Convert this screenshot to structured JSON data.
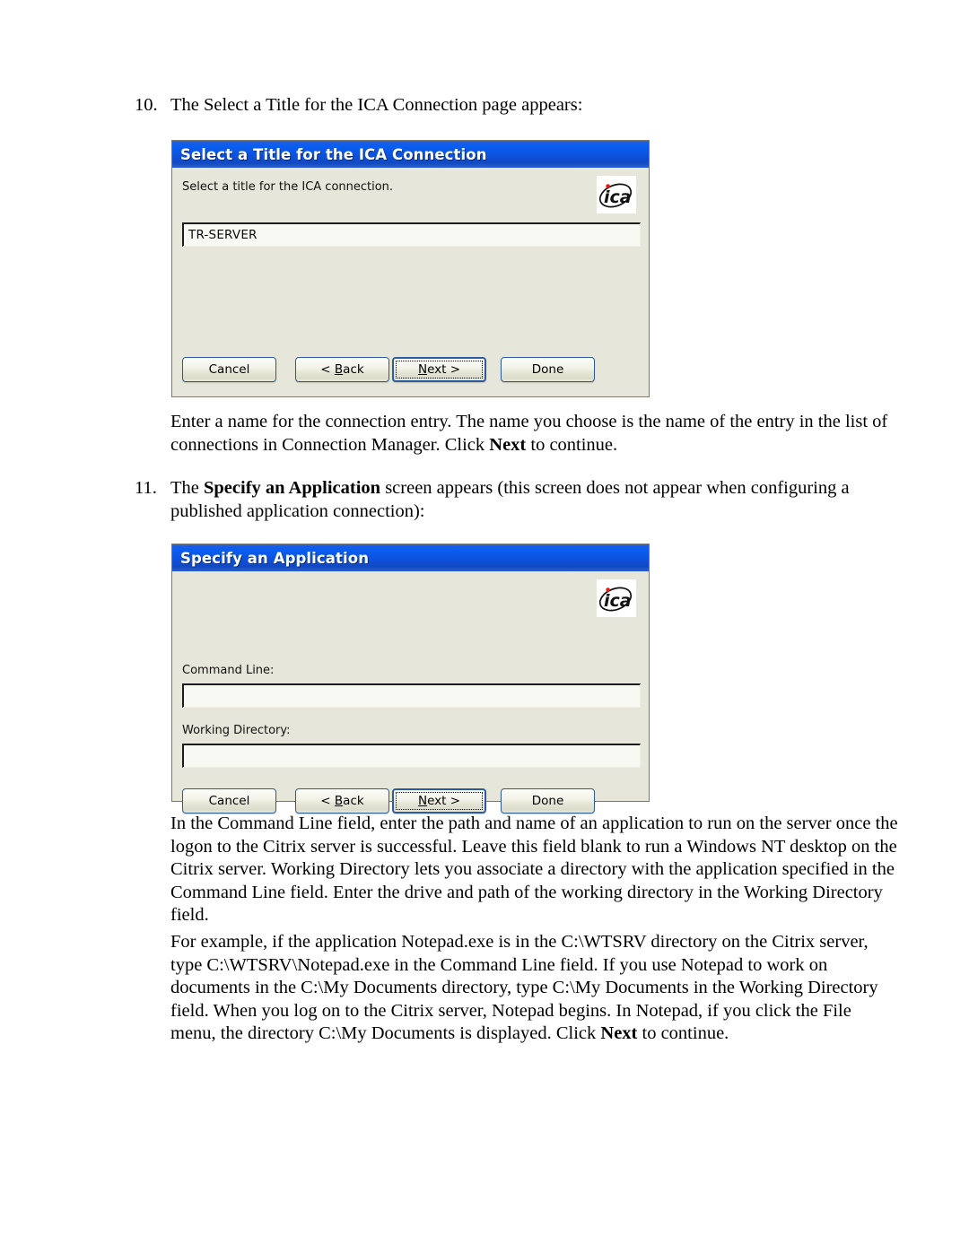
{
  "document": {
    "steps": [
      {
        "number": "10.",
        "text_parts": [
          {
            "text": "The Select a Title for the ICA Connection page appears:",
            "bold": false
          }
        ]
      },
      {
        "number": "11.",
        "text_parts": [
          {
            "text": "The ",
            "bold": false
          },
          {
            "text": "Specify an Application",
            "bold": true
          },
          {
            "text": " screen appears (this screen does not appear when configuring a published application connection):",
            "bold": false
          }
        ]
      }
    ],
    "paragraph_after_dialog1": [
      {
        "text": "Enter a name for the connection entry. The name you choose is the name of the entry in the list of connections in Connection Manager. Click ",
        "bold": false
      },
      {
        "text": "Next",
        "bold": true
      },
      {
        "text": " to continue.",
        "bold": false
      }
    ],
    "paragraph_after_dialog2_a": [
      {
        "text": "In the Command Line field, enter the path and name of an application to run on the server once the logon to the Citrix server is successful. Leave this field blank to run a Windows NT desktop on the Citrix server. Working Directory lets you associate a directory with the application specified in the Command Line field. Enter the drive and path of the working directory in the Working Directory field.",
        "bold": false
      }
    ],
    "paragraph_after_dialog2_b": [
      {
        "text": "For example, if the application Notepad.exe is in the C:\\WTSRV directory on the Citrix server, type C:\\WTSRV\\Notepad.exe in the Command Line field. If you use Notepad to work on documents in the C:\\My Documents directory, type C:\\My Documents in the Working Directory field. When you log on to the Citrix server, Notepad begins. In Notepad, if you click the File menu, the directory C:\\My Documents is displayed. Click ",
        "bold": false
      },
      {
        "text": "Next",
        "bold": true
      },
      {
        "text": " to continue.",
        "bold": false
      }
    ]
  },
  "dialog1": {
    "title": "Select a Title for the ICA Connection",
    "description": "Select a title for the ICA connection.",
    "logo": "ica-logo",
    "title_field": {
      "value": "TR-SERVER",
      "placeholder": ""
    },
    "buttons": {
      "cancel": "Cancel",
      "back_prefix": "< ",
      "back_accel": "B",
      "back_suffix": "ack",
      "next_accel": "N",
      "next_suffix": "ext >",
      "done": "Done"
    }
  },
  "dialog2": {
    "title": "Specify an Application",
    "logo": "ica-logo",
    "command_line_label": "Command Line:",
    "command_line_value": "",
    "working_directory_label": "Working Directory:",
    "working_directory_value": "",
    "buttons": {
      "cancel": "Cancel",
      "back_prefix": "< ",
      "back_accel": "B",
      "back_suffix": "ack",
      "next_accel": "N",
      "next_suffix": "ext >",
      "done": "Done"
    }
  },
  "colors": {
    "titlebar_blue": "#0b57e8",
    "dialog_face": "#e6e6da",
    "field_bg": "#f7f9f2",
    "logo_red_dot": "#e01b1b",
    "button_border": "#2f5d93"
  }
}
